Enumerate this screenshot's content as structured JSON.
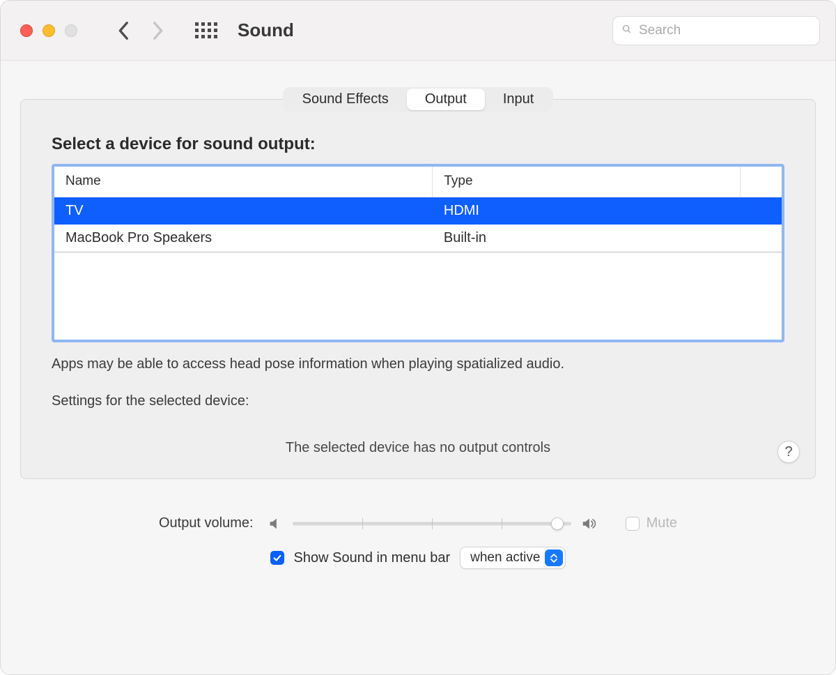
{
  "titlebar": {
    "title": "Sound",
    "search_placeholder": "Search"
  },
  "tabs": {
    "items": [
      "Sound Effects",
      "Output",
      "Input"
    ],
    "active_index": 1
  },
  "panel": {
    "heading": "Select a device for sound output:",
    "columns": {
      "name": "Name",
      "type": "Type"
    },
    "devices": [
      {
        "name": "TV",
        "type": "HDMI",
        "selected": true
      },
      {
        "name": "MacBook Pro Speakers",
        "type": "Built-in",
        "selected": false
      }
    ],
    "hint": "Apps may be able to access head pose information when playing spatialized audio.",
    "settings_label": "Settings for the selected device:",
    "no_controls": "The selected device has no output controls",
    "help_symbol": "?"
  },
  "volume": {
    "label": "Output volume:",
    "value_percent": 95,
    "mute_label": "Mute",
    "mute_checked": false
  },
  "menubar": {
    "show_checked": true,
    "label": "Show Sound in menu bar",
    "select_value": "when active"
  }
}
